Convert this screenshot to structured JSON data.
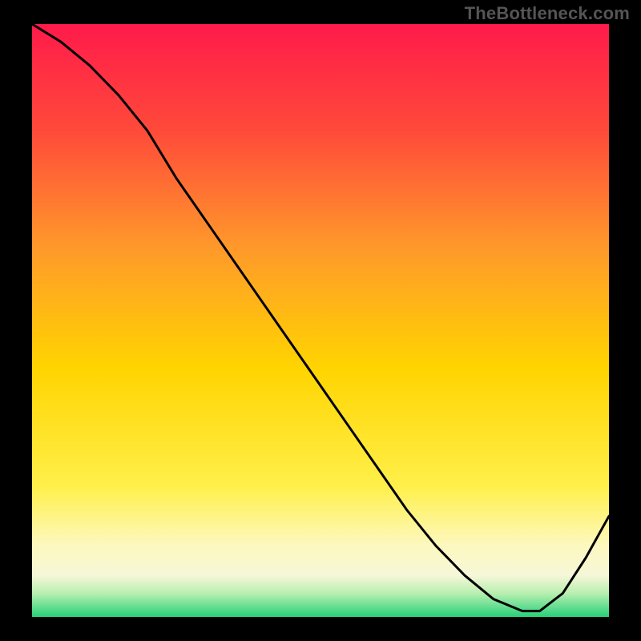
{
  "watermark": "TheBottleneck.com",
  "annotation": {
    "label": ""
  },
  "chart_data": {
    "type": "line",
    "title": "",
    "xlabel": "",
    "ylabel": "",
    "xlim": [
      0,
      100
    ],
    "ylim": [
      0,
      100
    ],
    "background_gradient": {
      "top_color": "#ff1a4a",
      "upper_mid_color": "#ff7a2a",
      "mid_color": "#ffd400",
      "lower_mid_color": "#fff88a",
      "band_color": "#fdf8d0",
      "bottom_color": "#27d07a"
    },
    "series": [
      {
        "name": "curve",
        "color": "#000000",
        "x": [
          0,
          5,
          10,
          15,
          20,
          25,
          30,
          35,
          40,
          45,
          50,
          55,
          60,
          65,
          70,
          75,
          80,
          85,
          88,
          92,
          96,
          100
        ],
        "y": [
          100,
          97,
          93,
          88,
          82,
          74,
          67,
          60,
          53,
          46,
          39,
          32,
          25,
          18,
          12,
          7,
          3,
          1,
          1,
          4,
          10,
          17
        ]
      }
    ],
    "annotation_region": {
      "x_start": 80,
      "x_end": 90,
      "y": 1
    }
  }
}
